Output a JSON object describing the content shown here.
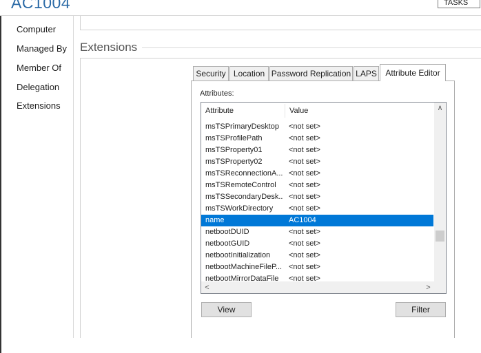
{
  "window": {
    "title": "AC1004",
    "tasks_label": "TASKS"
  },
  "nav": {
    "items": [
      "Computer",
      "Managed By",
      "Member Of",
      "Delegation",
      "Extensions"
    ]
  },
  "section": {
    "heading": "Extensions"
  },
  "tabs": [
    "Security",
    "Location",
    "Password Replication",
    "LAPS",
    "Attribute Editor"
  ],
  "active_tab": "Attribute Editor",
  "attributes": {
    "label": "Attributes:",
    "columns": {
      "attribute": "Attribute",
      "value": "Value"
    },
    "rows": [
      {
        "attr": "msTSPrimaryDesktop",
        "value": "<not set>"
      },
      {
        "attr": "msTSProfilePath",
        "value": "<not set>"
      },
      {
        "attr": "msTSProperty01",
        "value": "<not set>"
      },
      {
        "attr": "msTSProperty02",
        "value": "<not set>"
      },
      {
        "attr": "msTSReconnectionA...",
        "value": "<not set>"
      },
      {
        "attr": "msTSRemoteControl",
        "value": "<not set>"
      },
      {
        "attr": "msTSSecondaryDesk...",
        "value": "<not set>"
      },
      {
        "attr": "msTSWorkDirectory",
        "value": "<not set>"
      },
      {
        "attr": "name",
        "value": "AC1004",
        "selected": true
      },
      {
        "attr": "netbootDUID",
        "value": "<not set>"
      },
      {
        "attr": "netbootGUID",
        "value": "<not set>"
      },
      {
        "attr": "netbootInitialization",
        "value": "<not set>"
      },
      {
        "attr": "netbootMachineFileP...",
        "value": "<not set>"
      },
      {
        "attr": "netbootMirrorDataFile",
        "value": "<not set>"
      }
    ]
  },
  "buttons": {
    "view": "View",
    "filter": "Filter"
  },
  "colors": {
    "selection": "#0078d7",
    "title": "#2b6aa6"
  }
}
